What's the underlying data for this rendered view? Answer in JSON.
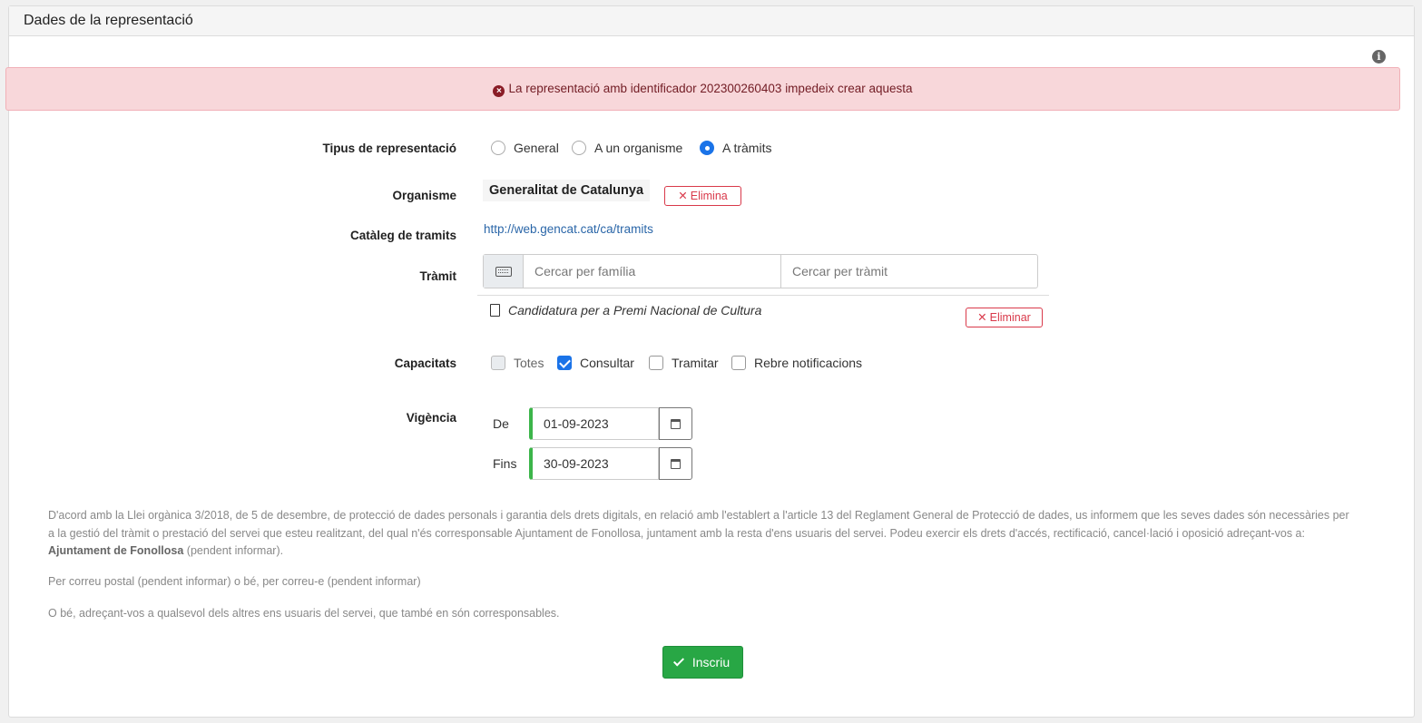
{
  "panel": {
    "title": "Dades de la representació"
  },
  "alert": {
    "message": "La representació amb identificador 202300260403 impedeix crear aquesta"
  },
  "tipus": {
    "label": "Tipus de representació",
    "options": [
      "General",
      "A un organisme",
      "A tràmits"
    ],
    "selected": "A tràmits"
  },
  "organisme": {
    "label": "Organisme",
    "value": "Generalitat de Catalunya",
    "delete_label": "Elimina"
  },
  "cataleg": {
    "label": "Catàleg de tramits",
    "url": "http://web.gencat.cat/ca/tramits"
  },
  "tramit": {
    "label": "Tràmit",
    "search_family_placeholder": "Cercar per família",
    "search_tramit_placeholder": "Cercar per tràmit",
    "selected_item": "Candidatura per a Premi Nacional de Cultura",
    "delete_label": "Eliminar"
  },
  "capacitats": {
    "label": "Capacitats",
    "options": [
      {
        "label": "Totes",
        "checked": false,
        "disabled": true
      },
      {
        "label": "Consultar",
        "checked": true,
        "disabled": false
      },
      {
        "label": "Tramitar",
        "checked": false,
        "disabled": false
      },
      {
        "label": "Rebre notificacions",
        "checked": false,
        "disabled": false
      }
    ]
  },
  "vigencia": {
    "label": "Vigència",
    "from_label": "De",
    "from_value": "01-09-2023",
    "to_label": "Fins",
    "to_value": "30-09-2023"
  },
  "legal": {
    "p1_text": "D'acord amb la Llei orgànica 3/2018, de 5 de desembre, de protecció de dades personals i garantia dels drets digitals, en relació amb l'establert a l'article 13 del Reglament General de Protecció de dades, us informem que les seves dades són necessàries per a la gestió del tràmit o prestació del servei que esteu realitzant, del qual n'és corresponsable Ajuntament de Fonollosa, juntament amb la resta d'ens usuaris del servei. Podeu exercir els drets d'accés, rectificació, cancel·lació i oposició adreçant-vos a:",
    "p1_entity": "Ajuntament de Fonollosa",
    "p1_suffix": "(pendent informar).",
    "p2": "Per correu postal (pendent informar) o bé, per correu-e (pendent informar)",
    "p3": "O bé, adreçant-vos a qualsevol dels altres ens usuaris del servei, que també en són corresponsables."
  },
  "submit": {
    "label": "Inscriu"
  },
  "colors": {
    "accent": "#1a73e8",
    "danger": "#d9394a",
    "success": "#28a745",
    "alert_bg": "#f8d7da"
  }
}
